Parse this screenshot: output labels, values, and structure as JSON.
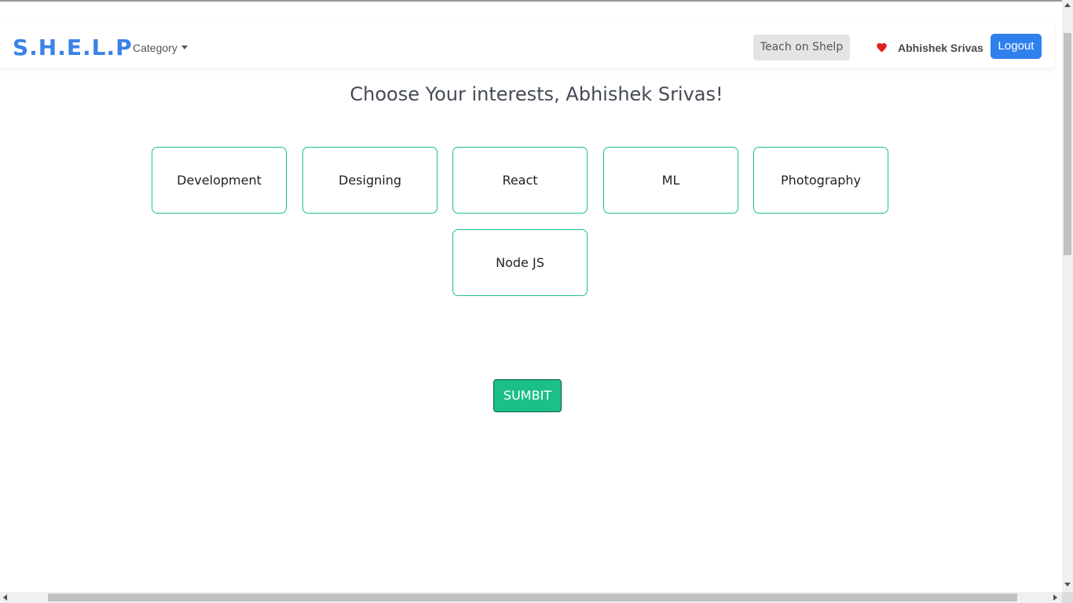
{
  "navbar": {
    "brand": "S.H.E.L.P",
    "category_label": "Category",
    "teach_label": "Teach on Shelp",
    "username": "Abhishek Srivas",
    "logout_label": "Logout",
    "brand_color": "#3b82e8",
    "logout_color": "#2f80ed",
    "heart_color": "#e0211f",
    "icons": {
      "category_caret": "caret-down-icon",
      "favorites": "heart-icon"
    }
  },
  "main": {
    "heading": "Choose Your interests, Abhishek Srivas!",
    "interests": [
      "Development",
      "Designing",
      "React",
      "ML",
      "Photography",
      "Node JS"
    ],
    "card_border_color": "#1fbf8f",
    "submit_label": "SUMBIT",
    "submit_color": "#1cbf86"
  }
}
